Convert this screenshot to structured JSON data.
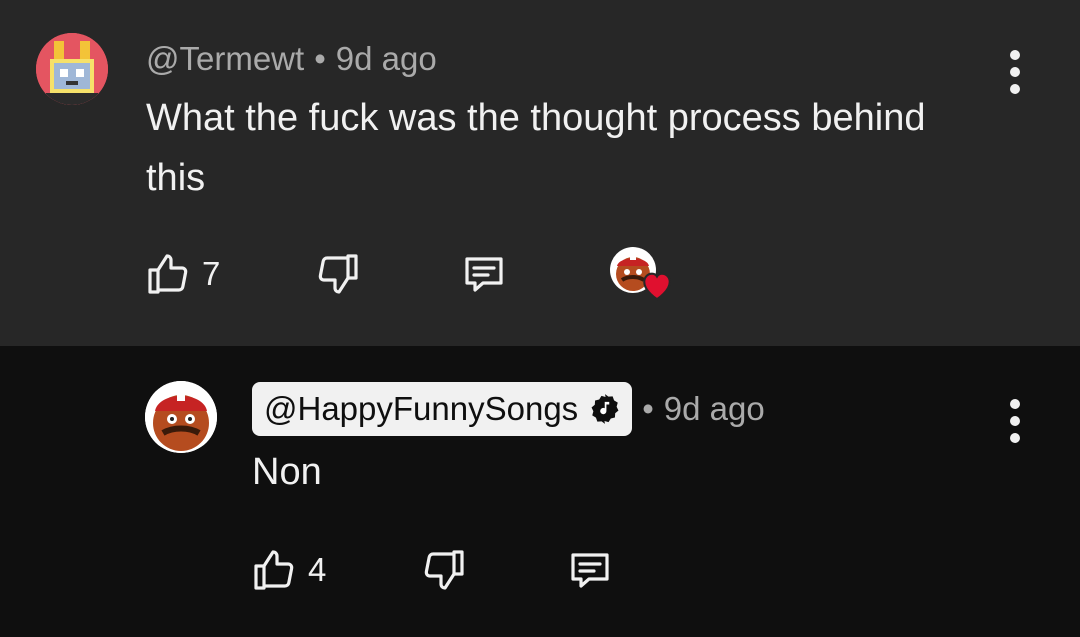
{
  "comments": [
    {
      "handle": "@Termewt",
      "time": "9d ago",
      "text": "What the fuck was the thought process behind this",
      "likes": "7"
    },
    {
      "handle": "@HappyFunnySongs",
      "time": "9d ago",
      "text": "Non",
      "likes": "4"
    }
  ],
  "icons": {
    "like": "thumbs-up-icon",
    "dislike": "thumbs-down-icon",
    "reply": "comment-icon",
    "more": "more-vert-icon",
    "heart": "heart-icon",
    "verified": "music-note-badge-icon"
  },
  "colors": {
    "top_bg": "#272727",
    "reply_bg": "#0f0f0f",
    "heart": "#e0102f"
  }
}
